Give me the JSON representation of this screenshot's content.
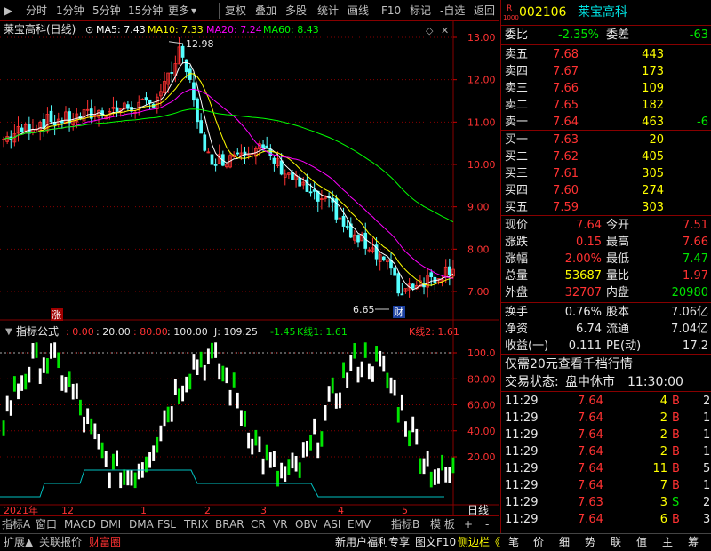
{
  "toolbar": {
    "items": [
      "分时",
      "1分钟",
      "5分钟",
      "15分钟",
      "更多",
      "复权",
      "叠加",
      "多股",
      "统计",
      "画线",
      "F10",
      "标记",
      "-自选",
      "返回"
    ],
    "more_arrow": "▶"
  },
  "stock": {
    "code": "002106",
    "name": "莱宝高科",
    "r_badge": "R",
    "level_badge": "1000"
  },
  "main_chart": {
    "title": "莱宝高科(日线)",
    "ma5": "MA5: 7.43",
    "ma10": "MA10: 7.33",
    "ma20": "MA20: 7.24",
    "ma60": "MA60: 8.43",
    "high_label": "12.98",
    "low_label": "6.65",
    "zhang_badge": "涨",
    "cai_badge": "财",
    "ticks": [
      "13.00",
      "12.00",
      "11.00",
      "10.00",
      "9.00",
      "8.00",
      "7.00"
    ]
  },
  "indicator": {
    "title": "指标公式",
    "v1": ": 0.00",
    "v2": ": 20.00",
    "v3": ": 80.00",
    "v4": ": 100.00",
    "j": "J: 109.25",
    "k1": "-1.45",
    "k1label": "K线1: 1.61",
    "k2label": "K线2: 1.61",
    "ticks": [
      "100.0",
      "80.00",
      "60.00",
      "40.00",
      "20.00"
    ]
  },
  "xaxis": {
    "labels": [
      "2021年",
      "12",
      "1",
      "2",
      "3",
      "4",
      "5"
    ],
    "right": "日线"
  },
  "footer_tabs": [
    "指标A",
    "窗口",
    "MACD",
    "DMI",
    "DMA",
    "FSL",
    "TRIX",
    "BRAR",
    "CR",
    "VR",
    "OBV",
    "ASI",
    "EMV",
    "指标B",
    "模 板",
    "+",
    "-"
  ],
  "bottom": {
    "left": [
      "扩展▲",
      "关联报价",
      "财富圈"
    ],
    "promo": "新用户福利专享",
    "f10": "图文F10",
    "side": "侧边栏《",
    "right_tabs": [
      "笔",
      "价",
      "细",
      "势",
      "联",
      "值",
      "主",
      "筹"
    ]
  },
  "quote": {
    "weibi_label": "委比",
    "weibi": "-2.35%",
    "weicha_label": "委差",
    "weicha": "-63",
    "sells": [
      {
        "label": "卖五",
        "price": "7.68",
        "vol": "443",
        "chg": ""
      },
      {
        "label": "卖四",
        "price": "7.67",
        "vol": "173",
        "chg": ""
      },
      {
        "label": "卖三",
        "price": "7.66",
        "vol": "109",
        "chg": ""
      },
      {
        "label": "卖二",
        "price": "7.65",
        "vol": "182",
        "chg": ""
      },
      {
        "label": "卖一",
        "price": "7.64",
        "vol": "463",
        "chg": "-6"
      }
    ],
    "buys": [
      {
        "label": "买一",
        "price": "7.63",
        "vol": "20"
      },
      {
        "label": "买二",
        "price": "7.62",
        "vol": "405"
      },
      {
        "label": "买三",
        "price": "7.61",
        "vol": "305"
      },
      {
        "label": "买四",
        "price": "7.60",
        "vol": "274"
      },
      {
        "label": "买五",
        "price": "7.59",
        "vol": "303"
      }
    ],
    "stats": [
      {
        "l1": "现价",
        "v1": "7.64",
        "l2": "今开",
        "v2": "7.51"
      },
      {
        "l1": "涨跌",
        "v1": "0.15",
        "l2": "最高",
        "v2": "7.66"
      },
      {
        "l1": "涨幅",
        "v1": "2.00%",
        "l2": "最低",
        "v2": "7.47"
      },
      {
        "l1": "总量",
        "v1": "53687",
        "l2": "量比",
        "v2": "1.97"
      },
      {
        "l1": "外盘",
        "v1": "32707",
        "l2": "内盘",
        "v2": "20980"
      }
    ],
    "stats2": [
      {
        "l1": "换手",
        "v1": "0.76%",
        "l2": "股本",
        "v2": "7.06亿"
      },
      {
        "l1": "净资",
        "v1": "6.74",
        "l2": "流通",
        "v2": "7.04亿"
      },
      {
        "l1": "收益(一)",
        "v1": "0.111",
        "l2": "PE(动)",
        "v2": "17.2"
      }
    ],
    "promo": "仅需20元查看千档行情",
    "status_label": "交易状态:",
    "status": "盘中休市",
    "status_time": "11:30:00",
    "ticks": [
      {
        "t": "11:29",
        "p": "7.64",
        "v": "4",
        "d": "B",
        "n": "2"
      },
      {
        "t": "11:29",
        "p": "7.64",
        "v": "2",
        "d": "B",
        "n": "1"
      },
      {
        "t": "11:29",
        "p": "7.64",
        "v": "2",
        "d": "B",
        "n": "1"
      },
      {
        "t": "11:29",
        "p": "7.64",
        "v": "2",
        "d": "B",
        "n": "1"
      },
      {
        "t": "11:29",
        "p": "7.64",
        "v": "11",
        "d": "B",
        "n": "5"
      },
      {
        "t": "11:29",
        "p": "7.64",
        "v": "7",
        "d": "B",
        "n": "1"
      },
      {
        "t": "11:29",
        "p": "7.63",
        "v": "3",
        "d": "S",
        "n": "2"
      },
      {
        "t": "11:29",
        "p": "7.64",
        "v": "6",
        "d": "B",
        "n": "3"
      }
    ]
  },
  "colors": {
    "up": "#ff3232",
    "down": "#00e600",
    "ma5": "#ffffff",
    "ma10": "#ffff00",
    "ma20": "#ff00ff",
    "ma60": "#00ff00",
    "grid": "#800000"
  }
}
